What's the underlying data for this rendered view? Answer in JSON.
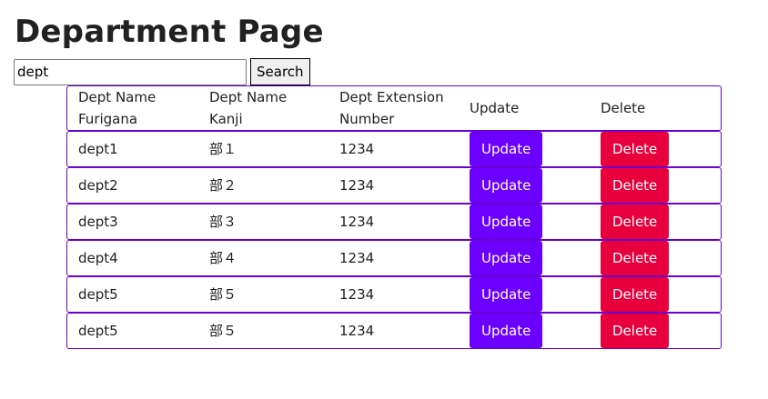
{
  "page": {
    "title": "Department Page"
  },
  "search": {
    "value": "dept",
    "button_label": "Search"
  },
  "table": {
    "headers": {
      "furigana_line1": "Dept Name",
      "furigana_line2": "Furigana",
      "kanji_line1": "Dept Name",
      "kanji_line2": "Kanji",
      "extension_line1": "Dept Extension",
      "extension_line2": "Number",
      "update": "Update",
      "delete": "Delete"
    },
    "rows": [
      {
        "furigana": "dept1",
        "kanji": "部１",
        "extension": "1234",
        "update_label": "Update",
        "delete_label": "Delete"
      },
      {
        "furigana": "dept2",
        "kanji": "部２",
        "extension": "1234",
        "update_label": "Update",
        "delete_label": "Delete"
      },
      {
        "furigana": "dept3",
        "kanji": "部３",
        "extension": "1234",
        "update_label": "Update",
        "delete_label": "Delete"
      },
      {
        "furigana": "dept4",
        "kanji": "部４",
        "extension": "1234",
        "update_label": "Update",
        "delete_label": "Delete"
      },
      {
        "furigana": "dept5",
        "kanji": "部５",
        "extension": "1234",
        "update_label": "Update",
        "delete_label": "Delete"
      },
      {
        "furigana": "dept5",
        "kanji": "部５",
        "extension": "1234",
        "update_label": "Update",
        "delete_label": "Delete"
      }
    ]
  },
  "colors": {
    "row_border": "#6a00d0",
    "update_button": "#6c00ff",
    "delete_button": "#e8003c"
  }
}
